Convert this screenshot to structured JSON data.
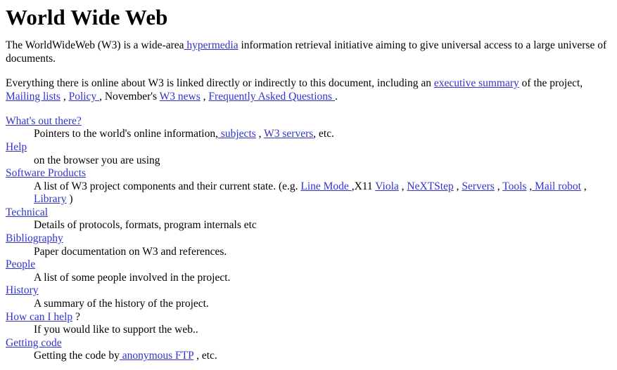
{
  "document": {
    "title": "World Wide Web",
    "link_color": "#3333cc",
    "text_color": "#000000",
    "background_color": "#ffffff"
  },
  "intro": {
    "part1": "The WorldWideWeb (W3) is a wide-area",
    "hypermedia_link": " hypermedia",
    "part2": " information retrieval initiative aiming to give universal access to a large universe of documents."
  },
  "everything": {
    "part1": "Everything there is online about W3 is linked directly or indirectly to this document, including an ",
    "executive_summary_link": "executive summary",
    "part2": " of the project, ",
    "mailing_lists_link": "Mailing lists",
    "sep1": " , ",
    "policy_link": "Policy ",
    "sep2": ", November's ",
    "w3_news_link": "W3 news",
    "sep3": " , ",
    "faq_link": "Frequently Asked Questions ",
    "sep4": "."
  },
  "menu": [
    {
      "term_link": "What's out there?",
      "term_suffix": "",
      "desc_parts": [
        {
          "type": "text",
          "value": "Pointers to the world's online information,"
        },
        {
          "type": "link",
          "value": " subjects"
        },
        {
          "type": "text",
          "value": " , "
        },
        {
          "type": "link",
          "value": "W3 servers"
        },
        {
          "type": "text",
          "value": ", etc."
        }
      ]
    },
    {
      "term_link": "Help",
      "term_suffix": "",
      "desc_parts": [
        {
          "type": "text",
          "value": "on the browser you are using"
        }
      ]
    },
    {
      "term_link": "Software Products",
      "term_suffix": "",
      "desc_parts": [
        {
          "type": "text",
          "value": "A list of W3 project components and their current state. (e.g. "
        },
        {
          "type": "link",
          "value": "Line Mode "
        },
        {
          "type": "text",
          "value": ",X11 "
        },
        {
          "type": "link",
          "value": "Viola"
        },
        {
          "type": "text",
          "value": " , "
        },
        {
          "type": "link",
          "value": "NeXTStep"
        },
        {
          "type": "text",
          "value": " , "
        },
        {
          "type": "link",
          "value": "Servers"
        },
        {
          "type": "text",
          "value": " , "
        },
        {
          "type": "link",
          "value": "Tools"
        },
        {
          "type": "text",
          "value": " ,"
        },
        {
          "type": "link",
          "value": " Mail robot"
        },
        {
          "type": "text",
          "value": " , "
        },
        {
          "type": "link",
          "value": "Library"
        },
        {
          "type": "text",
          "value": " )"
        }
      ]
    },
    {
      "term_link": "Technical",
      "term_suffix": "",
      "desc_parts": [
        {
          "type": "text",
          "value": "Details of protocols, formats, program internals etc"
        }
      ]
    },
    {
      "term_link": "Bibliography",
      "term_suffix": "",
      "desc_parts": [
        {
          "type": "text",
          "value": "Paper documentation on W3 and references."
        }
      ]
    },
    {
      "term_link": "People",
      "term_suffix": "",
      "desc_parts": [
        {
          "type": "text",
          "value": "A list of some people involved in the project."
        }
      ]
    },
    {
      "term_link": "History",
      "term_suffix": "",
      "desc_parts": [
        {
          "type": "text",
          "value": "A summary of the history of the project."
        }
      ]
    },
    {
      "term_link": "How can I help",
      "term_suffix": " ?",
      "desc_parts": [
        {
          "type": "text",
          "value": "If you would like to support the web.."
        }
      ]
    },
    {
      "term_link": "Getting code",
      "term_suffix": "",
      "desc_parts": [
        {
          "type": "text",
          "value": "Getting the code by"
        },
        {
          "type": "link",
          "value": " anonymous FTP"
        },
        {
          "type": "text",
          "value": " , etc."
        }
      ]
    }
  ]
}
